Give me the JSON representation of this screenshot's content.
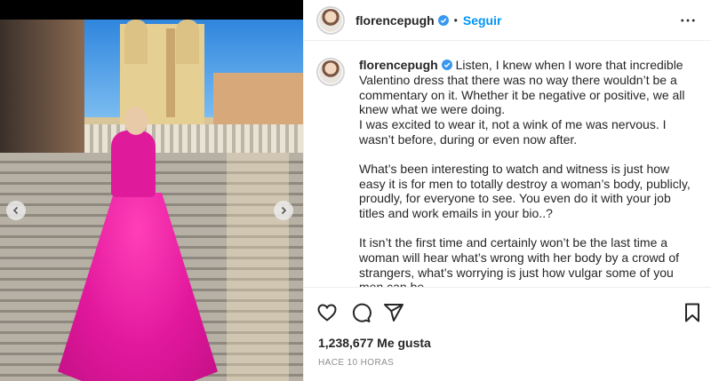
{
  "post": {
    "username": "florencepugh",
    "follow_label": "Seguir",
    "separator": "•",
    "caption_paragraphs": [
      "Listen, I knew when I wore that incredible Valentino dress that there was no way there wouldn’t be a commentary on it. Whether it be negative or positive, we all knew what we were doing.",
      "I was excited to wear it, not a wink of me was nervous. I wasn’t before, during or even now after.",
      "What’s been interesting to watch and witness is just how easy it is for men to totally destroy a woman’s body, publicly, proudly, for everyone to see. You even do it with your job titles and work emails in your bio..?",
      "It isn’t the first time and certainly won’t be the last time a woman will hear what’s wrong with her body by a crowd of strangers, what’s worrying is just how vulgar some of you men can be."
    ],
    "likes_text": "1,238,677 Me gusta",
    "time_text": "HACE 10 HORAS"
  },
  "icons": {
    "verified": "verified-badge-icon",
    "more": "more-options-icon",
    "like": "heart-icon",
    "comment": "comment-icon",
    "share": "share-icon",
    "save": "bookmark-icon",
    "prev": "chevron-left-icon",
    "next": "chevron-right-icon"
  },
  "colors": {
    "link_blue": "#0095f6",
    "verified_blue": "#3897f0",
    "text": "#262626",
    "muted": "#8e8e8e",
    "dress_pink": "#e01b9b"
  }
}
